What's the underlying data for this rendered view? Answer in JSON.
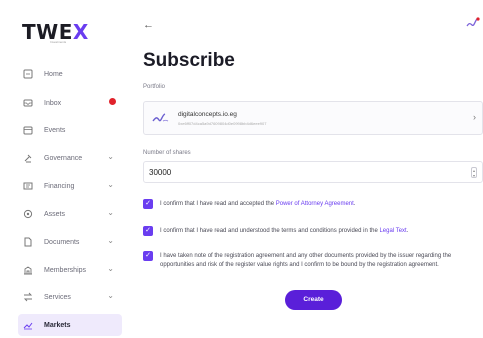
{
  "brand": {
    "logo_prefix": "TWE",
    "logo_x": "X",
    "logo_sub": "Investments",
    "accent": "#6a3df0"
  },
  "sidebar": {
    "items": [
      {
        "label": "Home",
        "icon": "home-icon"
      },
      {
        "label": "Inbox",
        "icon": "inbox-icon",
        "badge": true
      },
      {
        "label": "Events",
        "icon": "calendar-icon"
      },
      {
        "label": "Governance",
        "icon": "gavel-icon",
        "expandable": true
      },
      {
        "label": "Financing",
        "icon": "financing-icon",
        "expandable": true
      },
      {
        "label": "Assets",
        "icon": "assets-icon",
        "expandable": true
      },
      {
        "label": "Documents",
        "icon": "document-icon",
        "expandable": true
      },
      {
        "label": "Memberships",
        "icon": "building-icon",
        "expandable": true
      },
      {
        "label": "Services",
        "icon": "swap-icon",
        "expandable": true
      },
      {
        "label": "Markets",
        "icon": "chart-icon",
        "active": true
      }
    ]
  },
  "header": {
    "back_icon": "arrow-left-icon"
  },
  "main": {
    "title": "Subscribe",
    "portfolio_label": "Portfolio",
    "portfolio": {
      "name": "digitalconcepts.io.eg",
      "address": "0xe6ff07d4ca5a9d7609804d0e0998bb4d6eee907"
    },
    "shares_label": "Number of shares",
    "shares_value": "30000",
    "checks": [
      {
        "text_before": "I confirm that I have read and accepted the ",
        "link": "Power of Attorney Agreement",
        "text_after": ".",
        "checked": true
      },
      {
        "text_before": "I confirm that I have read and understood the terms and conditions provided in the ",
        "link": "Legal Text",
        "text_after": ".",
        "checked": true
      },
      {
        "text_before": "I have taken note of the registration agreement and any other documents provided by the issuer regarding the opportunities and risk of the register value rights and I confirm to be bound by the registration agreement.",
        "link": "",
        "text_after": "",
        "checked": true
      }
    ],
    "create_label": "Create"
  }
}
